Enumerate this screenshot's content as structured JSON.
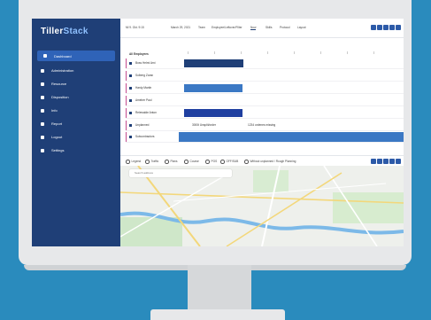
{
  "app": {
    "logo_a": "Tiller",
    "logo_b": "Stack"
  },
  "sidebar": {
    "items": [
      {
        "label": "Dashboard",
        "active": true,
        "icon": "grid-icon"
      },
      {
        "label": "Administration",
        "icon": "user-icon"
      },
      {
        "label": "Resource",
        "icon": "people-icon"
      },
      {
        "label": "Disposition",
        "icon": "gear-icon"
      },
      {
        "label": "Info",
        "icon": "info-icon"
      },
      {
        "label": "Report",
        "icon": "report-icon"
      },
      {
        "label": "Logout",
        "icon": "logout-icon"
      },
      {
        "label": "Settings",
        "icon": "settings-icon"
      }
    ]
  },
  "topbar": {
    "items": [
      {
        "label": "March 29, 2021"
      },
      {
        "label": "Team"
      },
      {
        "label": "Employee/Leftover/Filter"
      },
      {
        "label": "Now",
        "active": true
      },
      {
        "label": "Skills"
      },
      {
        "label": "Protocol"
      },
      {
        "label": "Layout"
      }
    ],
    "left_text": "Mi 9. Okt. 9:15"
  },
  "gantt": {
    "header": "All Employees",
    "rows": [
      {
        "label": "Boss Helmi Arni",
        "icon": "user-icon"
      },
      {
        "label": "Solberg Zoran",
        "icon": "user-icon"
      },
      {
        "label": "Hardy Martin",
        "icon": "user-icon"
      },
      {
        "label": "Ameber Paul",
        "icon": "user-icon"
      },
      {
        "label": "Relewalde Anton",
        "icon": "user-icon"
      },
      {
        "label": "Unplanned",
        "icon": "calendar-icon"
      },
      {
        "label": "Subcontractors",
        "icon": "truck-icon"
      }
    ],
    "unplanned_a": "3000t Unsplit/order",
    "unplanned_b": "1234 ordenes missing"
  },
  "map_tabs": [
    {
      "label": "Legend"
    },
    {
      "label": "Traffic"
    },
    {
      "label": "Plans"
    },
    {
      "label": "Course"
    },
    {
      "label": "POS"
    },
    {
      "label": "OFF/SUB"
    },
    {
      "label": "Without unplanned / Rough Planning"
    }
  ],
  "map": {
    "search_placeholder": "Search address"
  },
  "colors": {
    "background": "#2a8bbd",
    "sidebar": "#1f3f77",
    "accent": "#c34b8f",
    "bar_dark": "#1f3f77",
    "bar_mid": "#3b78c4",
    "bar_blue": "#2c5aa8"
  }
}
